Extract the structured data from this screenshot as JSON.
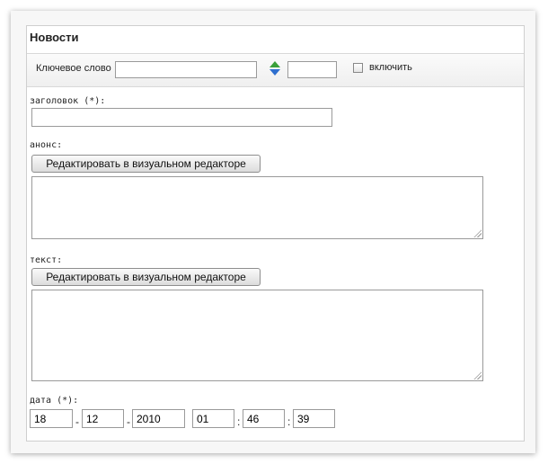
{
  "panel": {
    "title": "Новости"
  },
  "keyword": {
    "label": "Ключевое слово",
    "value": "",
    "number_value": "",
    "checkbox_label": "включить",
    "checked": false
  },
  "fields": {
    "heading": {
      "label": "заголовок (*):",
      "value": ""
    },
    "announce": {
      "label": "анонс:",
      "button": "Редактировать в визуальном редакторе",
      "value": ""
    },
    "text": {
      "label": "текст:",
      "button": "Редактировать в визуальном редакторе",
      "value": ""
    },
    "date": {
      "label": "дата (*):",
      "day": "18",
      "month": "12",
      "year": "2010",
      "hour": "01",
      "minute": "46",
      "second": "39",
      "date_sep": "-",
      "time_sep": ":"
    }
  },
  "colors": {
    "sort_up": "#3aa03a",
    "sort_down": "#2f6fcf"
  }
}
